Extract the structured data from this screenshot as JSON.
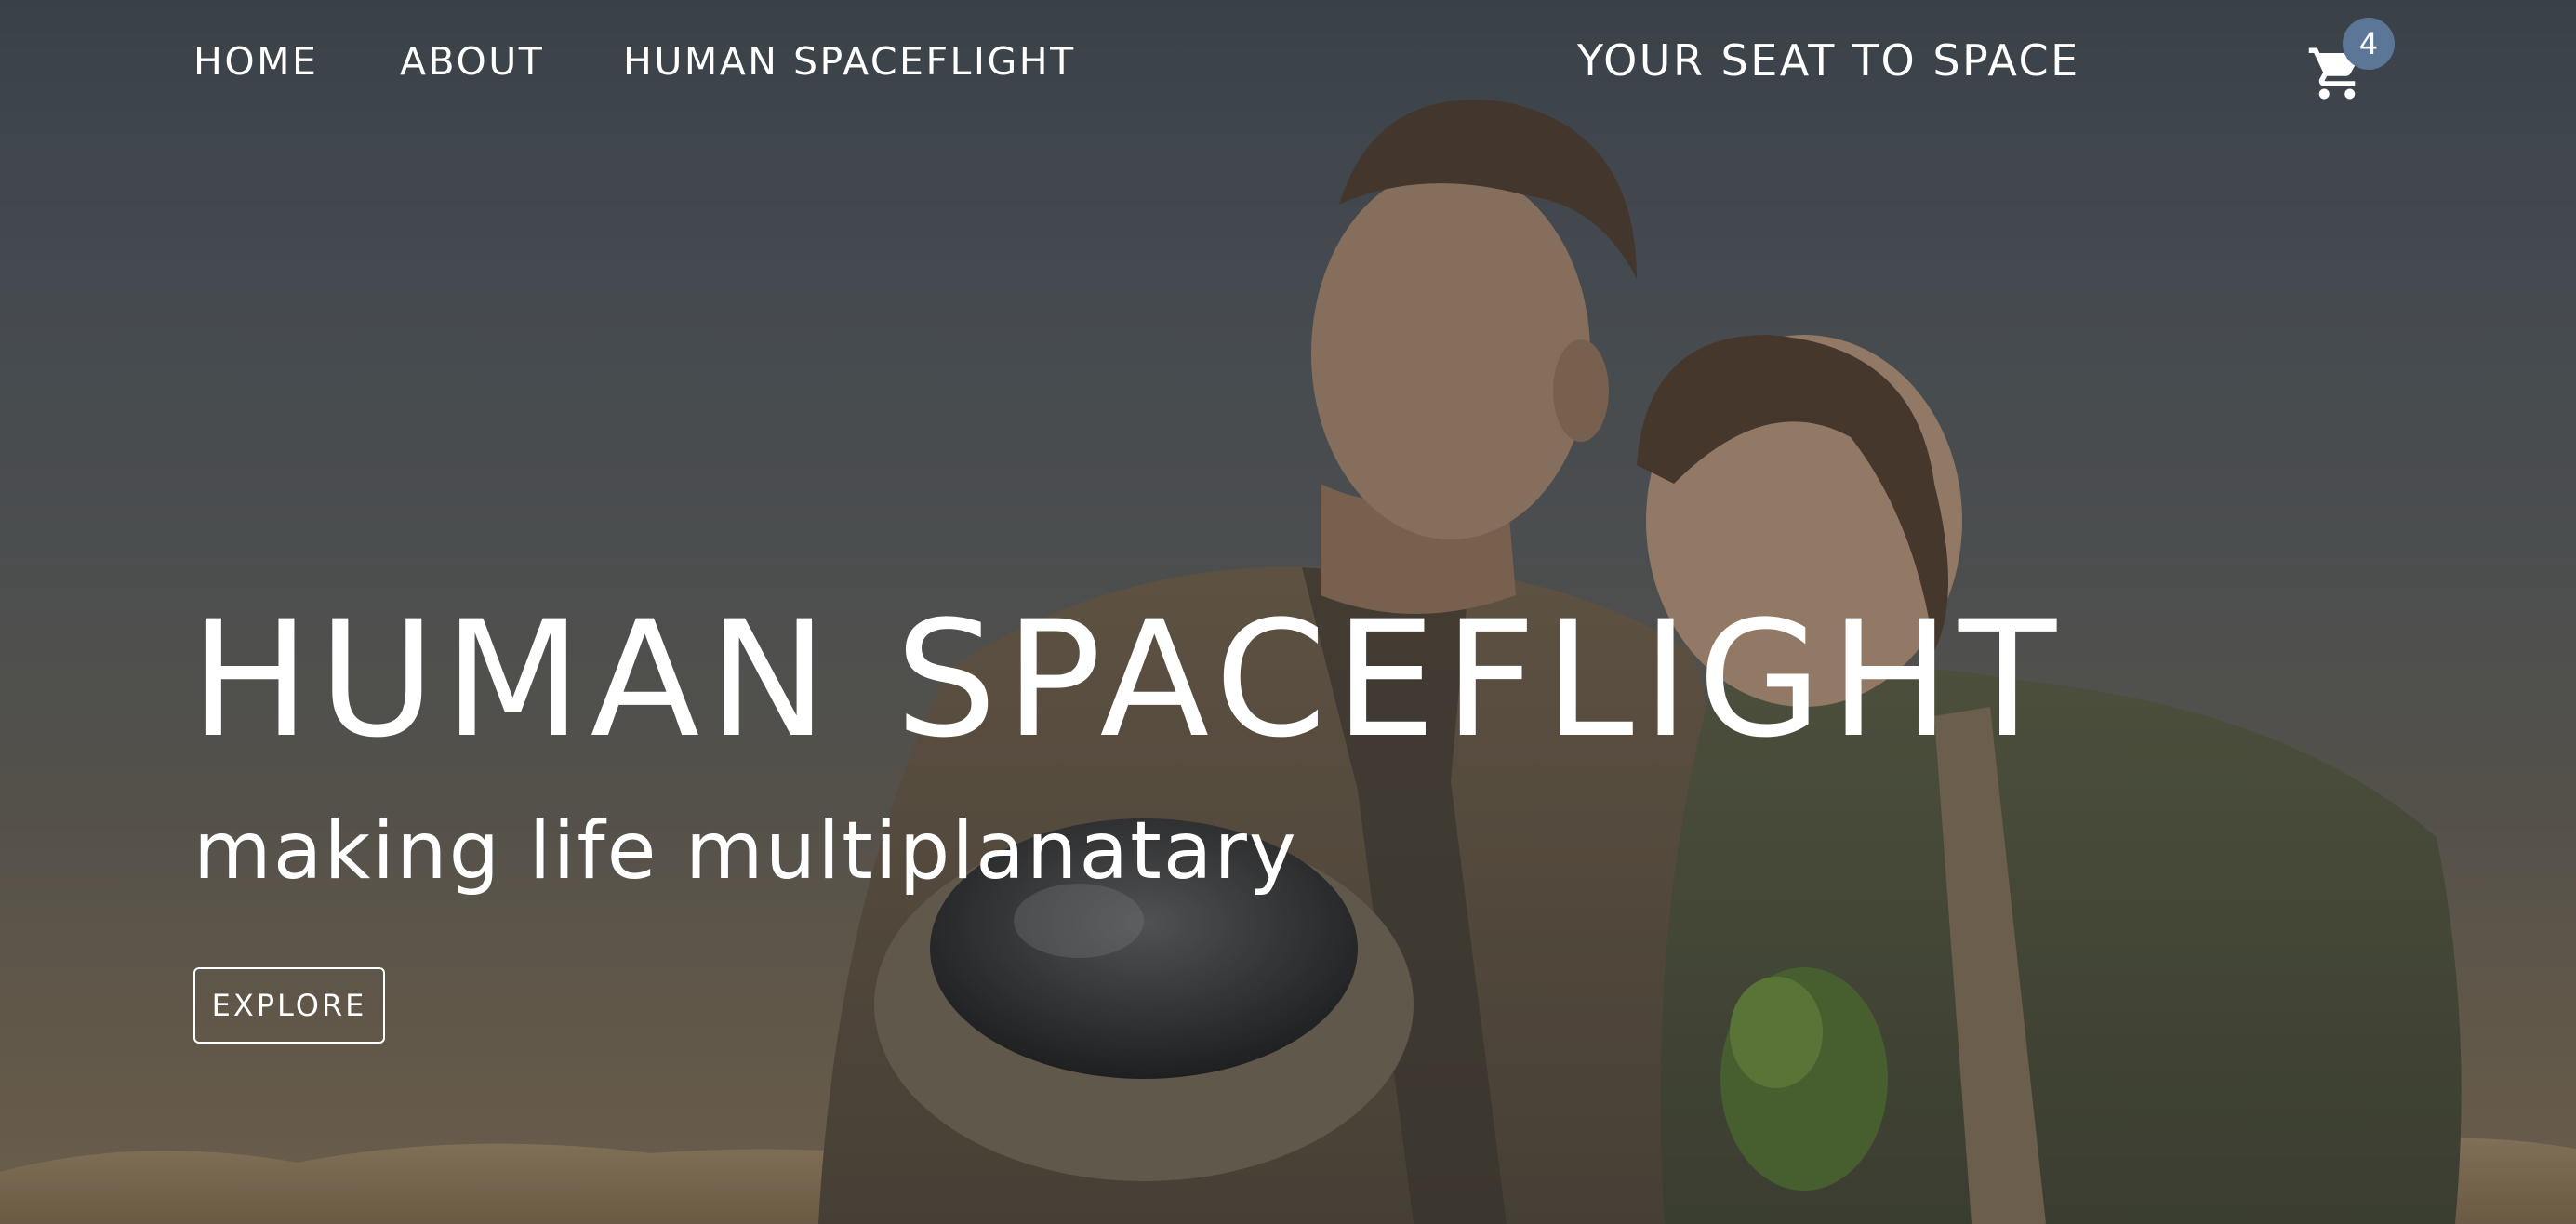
{
  "nav": {
    "links": [
      {
        "label": "HOME"
      },
      {
        "label": "ABOUT"
      },
      {
        "label": "HUMAN SPACEFLIGHT"
      }
    ],
    "tagline": "YOUR SEAT TO SPACE",
    "cart": {
      "icon": "shopping-cart-icon",
      "count": "4"
    }
  },
  "hero": {
    "title": "HUMAN SPACEFLIGHT",
    "subtitle": "making life multiplanatary",
    "cta_label": "EXPLORE",
    "image": "astronaut-couple-desert-photo"
  },
  "colors": {
    "badge": "#5c7697",
    "text": "#ffffff",
    "sky_top": "#3e464d",
    "sand": "#7b6a52"
  }
}
